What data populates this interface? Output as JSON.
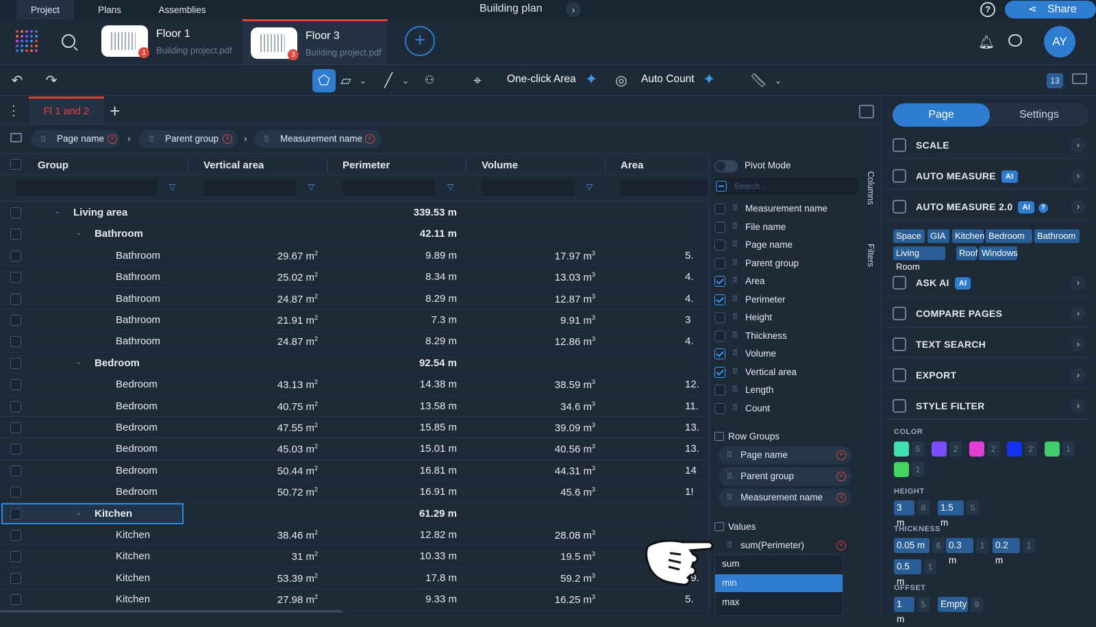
{
  "top_tabs": [
    "Project",
    "Plans",
    "Assemblies"
  ],
  "doc_title": "Building plan",
  "help_icon": "?",
  "share_label": "Share",
  "files": [
    {
      "title": "Floor 1",
      "subtitle": "Building project.pdf",
      "badge": "1"
    },
    {
      "title": "Floor 3",
      "subtitle": "Building project.pdf",
      "badge": "3"
    }
  ],
  "avatar_initials": "AY",
  "toolbar": {
    "one_click_area": "One-click Area",
    "auto_count": "Auto Count",
    "count_badge": "13"
  },
  "sheet_tab": "Fl 1 and 2",
  "group_chips": [
    "Page name",
    "Parent group",
    "Measurement name"
  ],
  "columns": [
    "Group",
    "Vertical area",
    "Perimeter",
    "Volume",
    "Area"
  ],
  "rows": [
    {
      "level": 0,
      "name": "Living area",
      "va": "",
      "per": "339.53 m",
      "vol": "",
      "area": "",
      "group": true
    },
    {
      "level": 1,
      "name": "Bathroom",
      "va": "",
      "per": "42.11 m",
      "vol": "",
      "area": "",
      "group": true
    },
    {
      "level": 2,
      "name": "Bathroom",
      "va": "29.67 m",
      "per": "9.89 m",
      "vol": "17.97 m",
      "area": "5."
    },
    {
      "level": 2,
      "name": "Bathroom",
      "va": "25.02 m",
      "per": "8.34 m",
      "vol": "13.03 m",
      "area": "4."
    },
    {
      "level": 2,
      "name": "Bathroom",
      "va": "24.87 m",
      "per": "8.29 m",
      "vol": "12.87 m",
      "area": "4."
    },
    {
      "level": 2,
      "name": "Bathroom",
      "va": "21.91 m",
      "per": "7.3 m",
      "vol": "9.91 m",
      "area": "3"
    },
    {
      "level": 2,
      "name": "Bathroom",
      "va": "24.87 m",
      "per": "8.29 m",
      "vol": "12.86 m",
      "area": "4."
    },
    {
      "level": 1,
      "name": "Bedroom",
      "va": "",
      "per": "92.54 m",
      "vol": "",
      "area": "",
      "group": true
    },
    {
      "level": 2,
      "name": "Bedroom",
      "va": "43.13 m",
      "per": "14.38 m",
      "vol": "38.59 m",
      "area": "12."
    },
    {
      "level": 2,
      "name": "Bedroom",
      "va": "40.75 m",
      "per": "13.58 m",
      "vol": "34.6 m",
      "area": "11."
    },
    {
      "level": 2,
      "name": "Bedroom",
      "va": "47.55 m",
      "per": "15.85 m",
      "vol": "39.09 m",
      "area": "13."
    },
    {
      "level": 2,
      "name": "Bedroom",
      "va": "45.03 m",
      "per": "15.01 m",
      "vol": "40.56 m",
      "area": "13."
    },
    {
      "level": 2,
      "name": "Bedroom",
      "va": "50.44 m",
      "per": "16.81 m",
      "vol": "44.31 m",
      "area": "14"
    },
    {
      "level": 2,
      "name": "Bedroom",
      "va": "50.72 m",
      "per": "16.91 m",
      "vol": "45.6 m",
      "area": "1!"
    },
    {
      "level": 1,
      "name": "Kitchen",
      "va": "",
      "per": "61.29 m",
      "vol": "",
      "area": "",
      "group": true,
      "selected": true
    },
    {
      "level": 2,
      "name": "Kitchen",
      "va": "38.46 m",
      "per": "12.82 m",
      "vol": "28.08 m",
      "area": ""
    },
    {
      "level": 2,
      "name": "Kitchen",
      "va": "31 m",
      "per": "10.33 m",
      "vol": "19.5 m",
      "area": ""
    },
    {
      "level": 2,
      "name": "Kitchen",
      "va": "53.39 m",
      "per": "17.8 m",
      "vol": "59.2 m",
      "area": "19."
    },
    {
      "level": 2,
      "name": "Kitchen",
      "va": "27.98 m",
      "per": "9.33 m",
      "vol": "16.25 m",
      "area": "5."
    }
  ],
  "unit_sup": {
    "area": "2",
    "volume": "3"
  },
  "side_panel": {
    "pivot_mode": "Pivot Mode",
    "search_placeholder": "Search...",
    "column_items": [
      {
        "label": "Measurement name",
        "checked": false
      },
      {
        "label": "File name",
        "checked": false
      },
      {
        "label": "Page name",
        "checked": false
      },
      {
        "label": "Parent group",
        "checked": false
      },
      {
        "label": "Area",
        "checked": true
      },
      {
        "label": "Perimeter",
        "checked": true
      },
      {
        "label": "Height",
        "checked": false
      },
      {
        "label": "Thickness",
        "checked": false
      },
      {
        "label": "Volume",
        "checked": true
      },
      {
        "label": "Vertical area",
        "checked": true
      },
      {
        "label": "Length",
        "checked": false
      },
      {
        "label": "Count",
        "checked": false
      }
    ],
    "row_groups_label": "Row Groups",
    "row_groups": [
      "Page name",
      "Parent group",
      "Measurement name"
    ],
    "values_label": "Values",
    "value_item": "sum(Perimeter)",
    "agg_options": [
      "sum",
      "min",
      "max"
    ],
    "agg_selected": "min",
    "strip_columns": "Columns",
    "strip_filters": "Filters"
  },
  "right_panel": {
    "tab_page": "Page",
    "tab_settings": "Settings",
    "menu": [
      {
        "label": "SCALE"
      },
      {
        "label": "AUTO MEASURE",
        "ai": "AI"
      },
      {
        "label": "AUTO MEASURE 2.0",
        "ai": "AI",
        "help": "?"
      }
    ],
    "tags": [
      "Space",
      "GIA",
      "Kitchen",
      "Bedroom",
      "Bathroom",
      "Living Room",
      "Roof",
      "Windows"
    ],
    "menu2": [
      {
        "label": "ASK AI",
        "ai": "AI"
      },
      {
        "label": "COMPARE PAGES"
      },
      {
        "label": "TEXT SEARCH"
      },
      {
        "label": "EXPORT"
      },
      {
        "label": "STYLE FILTER"
      }
    ],
    "color_label": "COLOR",
    "colors": [
      {
        "hex": "#3ee0b0",
        "count": "5"
      },
      {
        "hex": "#7b4dff",
        "count": "2"
      },
      {
        "hex": "#e23fd6",
        "count": "2"
      },
      {
        "hex": "#1230f0",
        "count": "2"
      },
      {
        "hex": "#3fcc6a",
        "count": "1"
      },
      {
        "hex": "#44d65c",
        "count": "1"
      }
    ],
    "height_label": "HEIGHT",
    "heights": [
      {
        "v": "3 m",
        "c": "8"
      },
      {
        "v": "1.5 m",
        "c": "5"
      }
    ],
    "thickness_label": "THICKNESS",
    "thickness": [
      {
        "v": "0.05 m",
        "c": "6"
      },
      {
        "v": "0.3 m",
        "c": "1"
      },
      {
        "v": "0.2 m",
        "c": "1"
      },
      {
        "v": "0.5 m",
        "c": "1"
      }
    ],
    "offset_label": "OFFSET",
    "offsets": [
      {
        "v": "1 m",
        "c": "5"
      },
      {
        "v": "Empty",
        "c": "9"
      }
    ]
  },
  "accent": "#2e7dd1",
  "danger": "#e0443a"
}
